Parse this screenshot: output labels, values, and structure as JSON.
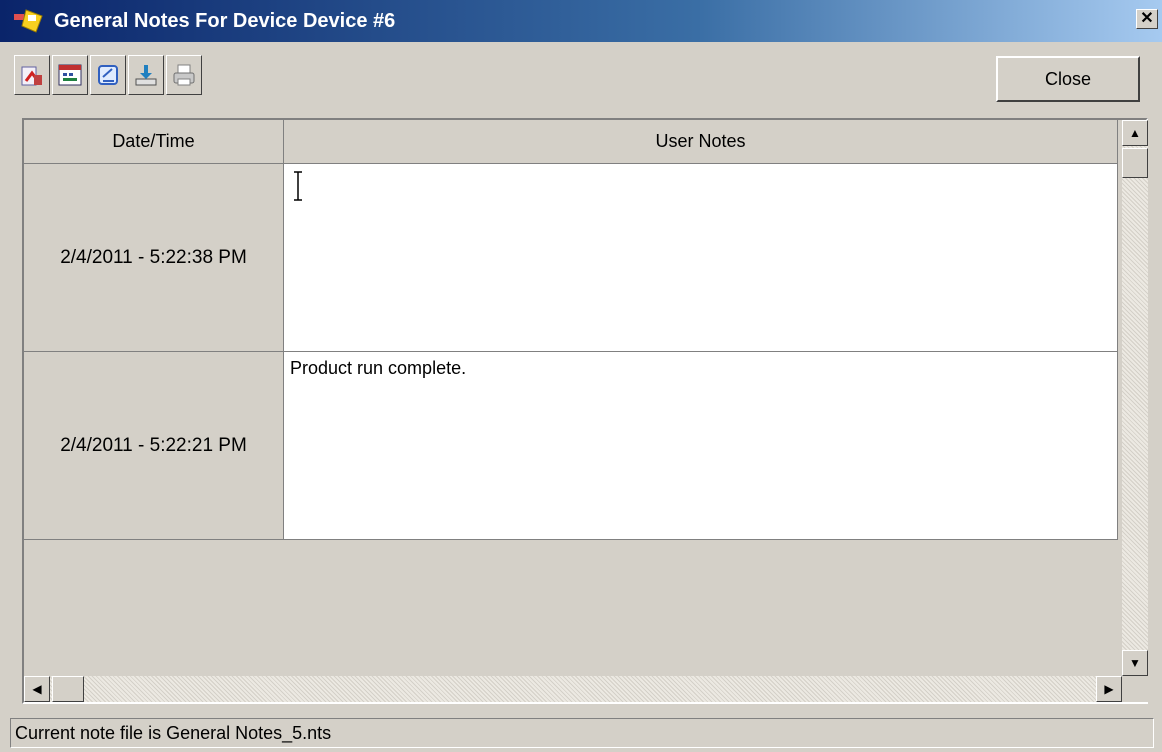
{
  "window": {
    "title": "General Notes For Device Device #6",
    "close_glyph": "✕"
  },
  "toolbar": {
    "buttons": [
      {
        "icon": "export-notes-icon"
      },
      {
        "icon": "calendar-icon"
      },
      {
        "icon": "edit-note-icon"
      },
      {
        "icon": "download-icon"
      },
      {
        "icon": "print-icon"
      }
    ],
    "close_label": "Close"
  },
  "grid": {
    "columns": [
      "Date/Time",
      "User Notes"
    ],
    "rows": [
      {
        "date": "2/4/2011 - 5:22:38 PM",
        "note": ""
      },
      {
        "date": "2/4/2011 - 5:22:21 PM",
        "note": "Product run complete."
      }
    ]
  },
  "status": {
    "text": "Current note file is General Notes_5.nts"
  }
}
